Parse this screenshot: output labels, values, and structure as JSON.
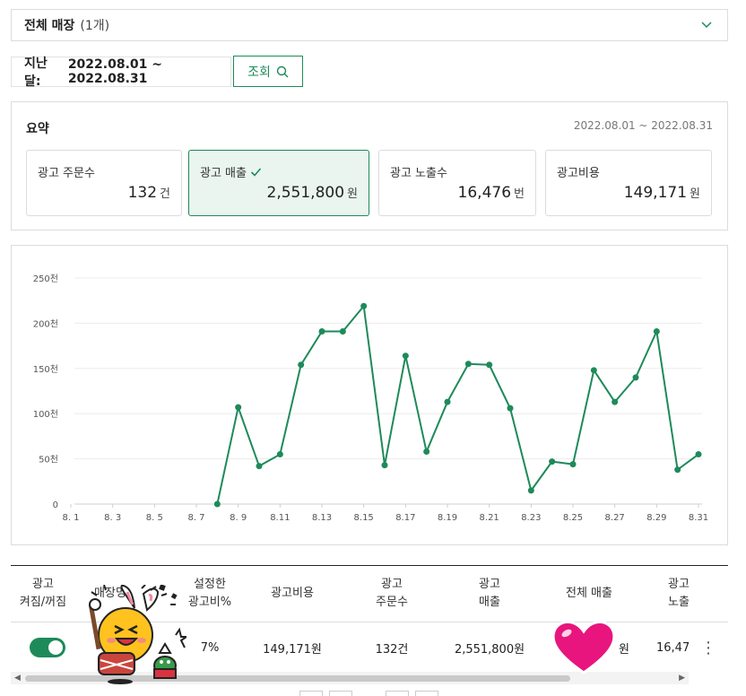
{
  "store_select": {
    "label": "전체 매장",
    "count": "(1개)"
  },
  "period": {
    "label": "지난 달:",
    "range": "2022.08.01 ~ 2022.08.31"
  },
  "search_button": {
    "label": "조회"
  },
  "summary": {
    "title": "요약",
    "range": "2022.08.01 ~ 2022.08.31",
    "cards": [
      {
        "label": "광고 주문수",
        "value": "132",
        "unit": "건",
        "active": false
      },
      {
        "label": "광고 매출",
        "value": "2,551,800",
        "unit": "원",
        "active": true
      },
      {
        "label": "광고 노출수",
        "value": "16,476",
        "unit": "번",
        "active": false
      },
      {
        "label": "광고비용",
        "value": "149,171",
        "unit": "원",
        "active": false
      }
    ]
  },
  "colors": {
    "accent": "#1e8a5a",
    "active_card_bg": "#e9f5ee",
    "line": "#1e8a5a"
  },
  "chart_data": {
    "type": "line",
    "ylim": [
      0,
      250
    ],
    "y_ticks": [
      "0",
      "50천",
      "100천",
      "150천",
      "200천",
      "250천"
    ],
    "x_ticks": [
      "8. 1",
      "8. 3",
      "8. 5",
      "8. 7",
      "8. 9",
      "8.11",
      "8.13",
      "8.15",
      "8.17",
      "8.19",
      "8.21",
      "8.23",
      "8.25",
      "8.27",
      "8.29",
      "8.31"
    ],
    "x": [
      "8.8",
      "8.9",
      "8.10",
      "8.11",
      "8.12",
      "8.13",
      "8.14",
      "8.15",
      "8.16",
      "8.17",
      "8.18",
      "8.19",
      "8.20",
      "8.21",
      "8.22",
      "8.23",
      "8.24",
      "8.25",
      "8.26",
      "8.27",
      "8.28",
      "8.29",
      "8.30",
      "8.31"
    ],
    "series": [
      {
        "values": [
          0,
          107,
          42,
          55,
          154,
          191,
          191,
          219,
          43,
          164,
          58,
          113,
          155,
          154,
          106,
          15,
          47,
          44,
          148,
          113,
          140,
          191,
          38,
          55
        ]
      }
    ],
    "grid": true,
    "legend": "none"
  },
  "table": {
    "headers": [
      "광고\n켜짐/꺼짐",
      "매장명",
      "설정한\n광고비%",
      "광고비용",
      "광고\n주문수",
      "광고\n매출",
      "전체 매출",
      "광고\n노출"
    ],
    "row": {
      "toggle_on": true,
      "store": "",
      "ad_rate": "7%",
      "ad_cost": "149,171원",
      "orders": "132건",
      "ad_sales": "2,551,800원",
      "total_sales": "원",
      "impressions": "16,47"
    }
  }
}
